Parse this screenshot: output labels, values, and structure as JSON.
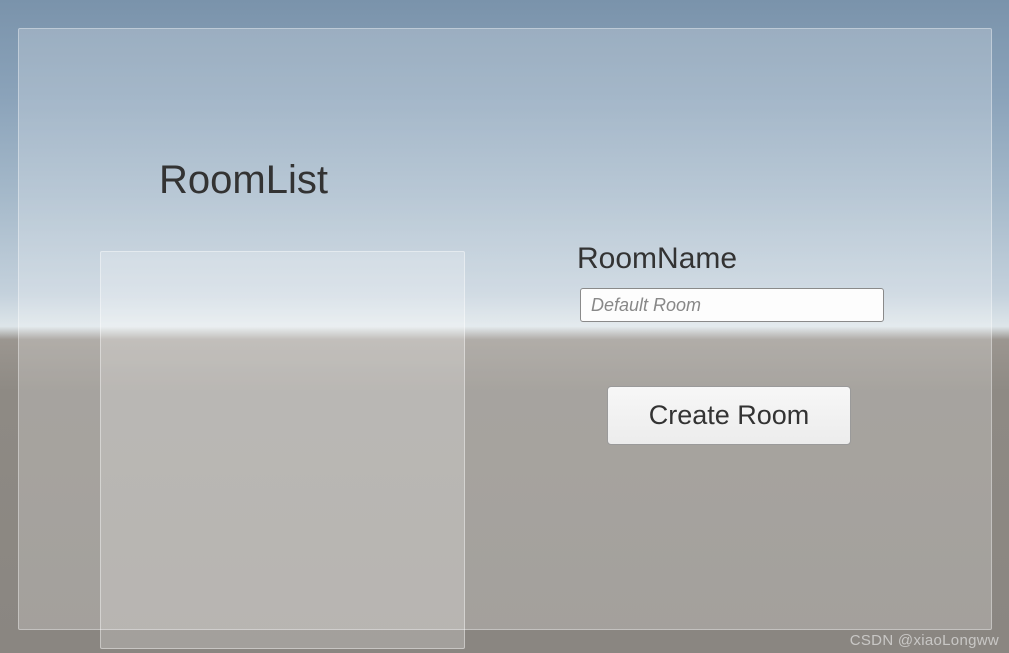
{
  "labels": {
    "room_list": "RoomList",
    "room_name": "RoomName"
  },
  "input": {
    "room_name_placeholder": "Default Room",
    "room_name_value": ""
  },
  "buttons": {
    "create_room": "Create Room"
  },
  "watermark": "CSDN @xiaoLongww"
}
